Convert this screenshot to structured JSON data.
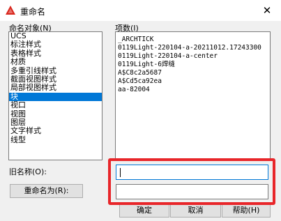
{
  "window": {
    "title": "重命名",
    "close_glyph": "✕"
  },
  "labels": {
    "named_objects": "命名对象(N)",
    "items": "项数(I)",
    "old_name": "旧名称(O):"
  },
  "named_objects": [
    {
      "label": "UCS",
      "selected": false
    },
    {
      "label": "标注样式",
      "selected": false
    },
    {
      "label": "表格样式",
      "selected": false
    },
    {
      "label": "材质",
      "selected": false
    },
    {
      "label": "多重引线样式",
      "selected": false
    },
    {
      "label": "截面视图样式",
      "selected": false
    },
    {
      "label": "局部视图样式",
      "selected": false
    },
    {
      "label": "块",
      "selected": true
    },
    {
      "label": "视口",
      "selected": false
    },
    {
      "label": "视图",
      "selected": false
    },
    {
      "label": "图层",
      "selected": false
    },
    {
      "label": "文字样式",
      "selected": false
    },
    {
      "label": "线型",
      "selected": false
    }
  ],
  "items": [
    "_ARCHTICK",
    "0119Light-220104-a-20211012.17243300",
    "0119Light-220104-a-center",
    "0119Light-6焊缝",
    "A$C8c2a5687",
    "A$Cd5ca92ea",
    "aa-82004"
  ],
  "fields": {
    "old_name_value": "",
    "new_name_value": ""
  },
  "buttons": {
    "rename_to": "重命名为(R):",
    "ok": "确定",
    "cancel": "取消",
    "help": "帮助(H)"
  },
  "colors": {
    "selection": "#0078d7",
    "highlight_box": "#e8262a",
    "app_icon": "#d9261c"
  },
  "icons": {
    "app": "autocad-triangle-icon",
    "close": "close-icon"
  }
}
